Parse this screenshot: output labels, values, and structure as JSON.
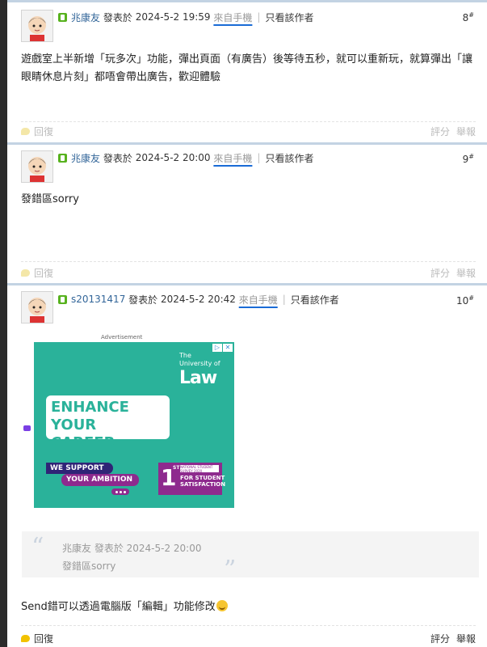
{
  "posts": [
    {
      "floor": "8",
      "author": "兆康友",
      "posted_prefix": "發表於",
      "time": "2024-5-2 19:59",
      "source": "來自手機",
      "only_author": "只看該作者",
      "content": "遊戲室上半新增「玩多次」功能，彈出頁面（有廣告）後等待五秒，就可以重新玩，就算彈出「讓眼睛休息片刻」都唔會帶出廣告，歡迎體驗",
      "reply": "回復",
      "rate": "評分",
      "report": "舉報"
    },
    {
      "floor": "9",
      "author": "兆康友",
      "posted_prefix": "發表於",
      "time": "2024-5-2 20:00",
      "source": "來自手機",
      "only_author": "只看該作者",
      "content": "發錯區sorry",
      "reply": "回復",
      "rate": "評分",
      "report": "舉報"
    },
    {
      "floor": "10",
      "author": "s20131417",
      "posted_prefix": "發表於",
      "time": "2024-5-2 20:42",
      "source": "來自手機",
      "only_author": "只看該作者",
      "ad_label": "Advertisement",
      "ad": {
        "university_line1": "The",
        "university_line2": "University of",
        "brand": "Law",
        "headline_line1": "ENHANCE",
        "headline_line2": "YOUR CAREER",
        "support": "WE SUPPORT",
        "ambition": "YOUR AMBITION",
        "rank_number": "1",
        "rank_suffix": "ST",
        "survey_label": "NATIONAL STUDENT SURVEY 2020",
        "survey_line1": "FOR STUDENT",
        "survey_line2": "SATISFACTION",
        "badge_icon": "adchoices-icon"
      },
      "quote": {
        "author_line": "兆康友 發表於 2024-5-2 20:00",
        "text": "發錯區sorry"
      },
      "content": "Send錯可以透過電腦版「編輯」功能修改",
      "reply": "回復",
      "rate": "評分",
      "report": "舉報"
    }
  ],
  "colors": {
    "author_link": "#336699",
    "post_border": "#c3d3e3",
    "ad_background": "#2ab29a",
    "ad_purple": "#8e2a8e",
    "underline": "#1a6bd6"
  }
}
